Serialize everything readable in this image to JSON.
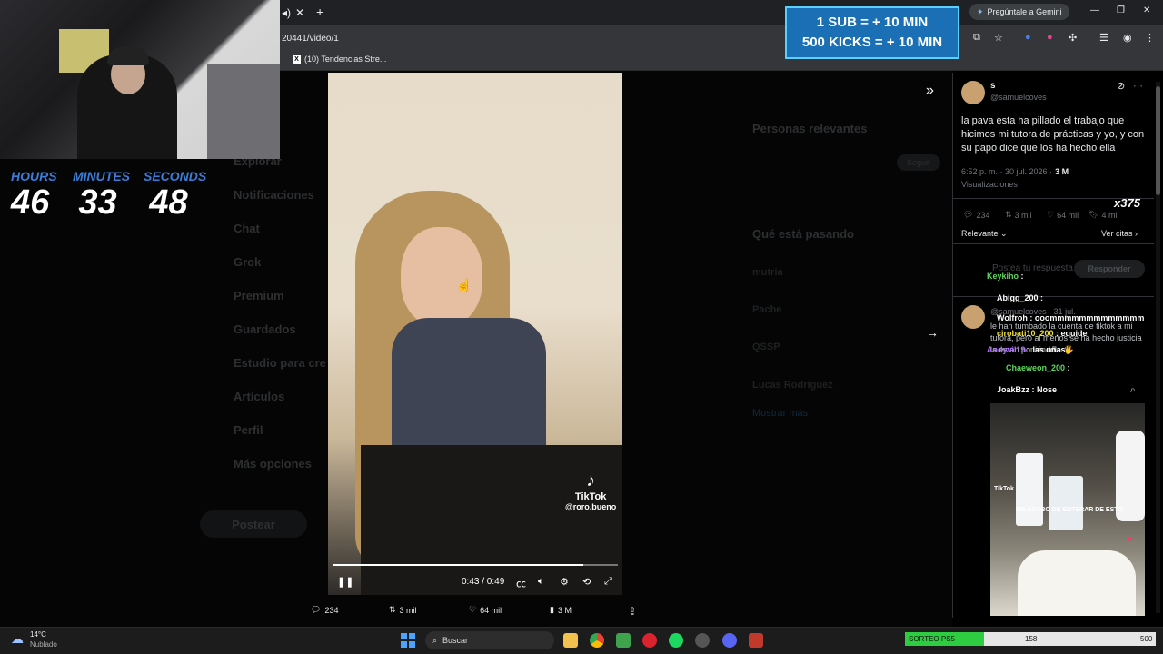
{
  "browser": {
    "url": "20441/video/1",
    "bookmark_tab": "(10) Tendencias Stre...",
    "gemini_button": "Pregúntale a Gemini"
  },
  "webcam": {},
  "timer": {
    "hours_label": "HOURS",
    "hours": "46",
    "minutes_label": "MINUTES",
    "minutes": "33",
    "seconds_label": "SECONDS",
    "seconds": "48"
  },
  "subs_banner": {
    "line1": "1 SUB = + 10 MIN",
    "line2": "500 KICKS = + 10 MIN"
  },
  "background_page": {
    "nav": [
      "Explorar",
      "Notificaciones",
      "Chat",
      "Grok",
      "Premium",
      "Guardados",
      "Estudio para cre",
      "Artículos",
      "Perfil",
      "Más opciones"
    ],
    "post_button": "Postear",
    "relevant_heading": "Personas relevantes",
    "trending_heading": "Qué está pasando",
    "trends": [
      "mutria",
      "Pache",
      "QSSP",
      "Lucas Rodríguez"
    ],
    "follow_button": "Seguir",
    "show_more": "Mostrar más"
  },
  "video": {
    "watermark": "TikTok",
    "handle": "@roro.bueno",
    "time": "0:43 / 0:49",
    "progress": 0.88
  },
  "video_actions": {
    "replies": "234",
    "reposts": "3 mil",
    "likes": "64 mil",
    "views": "3 M"
  },
  "post": {
    "name": "s",
    "handle": "@samuelcoves",
    "text": "la pava esta ha pillado el trabajo que hicimos mi tutora de prácticas y yo, y con su papo dice que los ha hecho ella",
    "timestamp": "6:52 p. m. · 30 jul. 2026 ·",
    "views_count": "3 M",
    "views_label": "Visualizaciones",
    "replies": "234",
    "reposts": "3 mil",
    "likes": "64 mil",
    "bookmarks": "4 mil",
    "sort_label": "Relevante",
    "quotes_link": "Ver citas",
    "reply_button": "Responder",
    "reply_placeholder": "Postea tu respuesta",
    "reply_author": "@samuelcoves · 31 jul.",
    "reply_text": "le han tumbado la cuenta de tiktok a mi tutora, pero al menos se ha hecho justicia la están poniéndola 🖐️"
  },
  "chat": [
    {
      "user": "Keykiho",
      "color": "#5cd65c",
      "msg": ""
    },
    {
      "user": "Abigg_200",
      "color": "#ffffff",
      "msg": ""
    },
    {
      "user": "Wolfroh",
      "color": "#ffffff",
      "msg": "ooommmmmmmmmmmmm"
    },
    {
      "user": "cirobati10_200",
      "color": "#f0e040",
      "msg": "equide"
    },
    {
      "user": "Andyvil19",
      "color": "#b070ff",
      "msg": "las uñas"
    },
    {
      "user": "Chaeweon_200",
      "color": "#5cd65c",
      "msg": ""
    },
    {
      "user": "JoakBzz",
      "color": "#ffffff",
      "msg": "Nose"
    }
  ],
  "overlay_counter": "x375",
  "chat_video": {
    "caption": "ME ACABO DE ENTERAR DE ESTO",
    "watermark": "TikTok"
  },
  "taskbar": {
    "weather_temp": "14°C",
    "weather_desc": "Nublado",
    "search_label": "Buscar"
  },
  "sorteo": {
    "label": "SORTEO PS5",
    "current": "158",
    "goal": "500",
    "fraction": 0.316
  },
  "colors": {
    "accent_blue": "#3b7dd8",
    "banner_bg": "#1a6fb5",
    "progress_green": "#2ecc40"
  }
}
